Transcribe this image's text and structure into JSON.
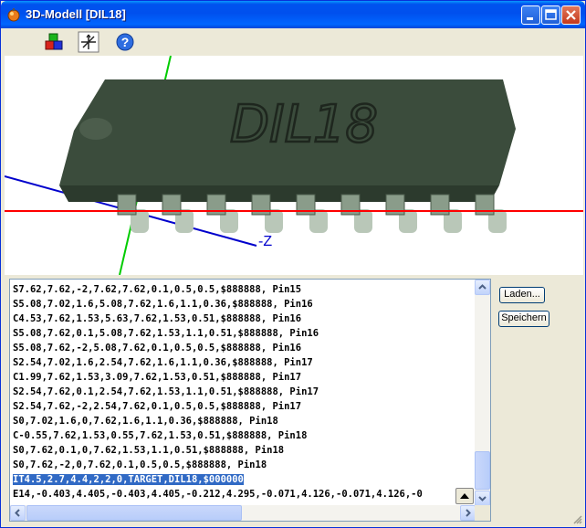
{
  "window": {
    "title": "3D-Modell  [DIL18]",
    "colors": {
      "titlebar": "#0054e3",
      "chip_body": "#3b4c3c",
      "chip_text": "#283028",
      "axis_x": "#ff0000",
      "axis_y": "#00cc00",
      "axis_z": "#0000cc"
    }
  },
  "toolbar": {
    "icons": [
      "color-cubes-icon",
      "axes-icon",
      "help-icon"
    ]
  },
  "view3d": {
    "chip_label": "DIL18",
    "axis_label": "-Z"
  },
  "editor": {
    "lines": [
      "S7.62,7.62,-2,7.62,7.62,0.1,0.5,0.5,$888888, Pin15",
      "S5.08,7.02,1.6,5.08,7.62,1.6,1.1,0.36,$888888, Pin16",
      "C4.53,7.62,1.53,5.63,7.62,1.53,0.51,$888888, Pin16",
      "S5.08,7.62,0.1,5.08,7.62,1.53,1.1,0.51,$888888, Pin16",
      "S5.08,7.62,-2,5.08,7.62,0.1,0.5,0.5,$888888, Pin16",
      "S2.54,7.02,1.6,2.54,7.62,1.6,1.1,0.36,$888888, Pin17",
      "C1.99,7.62,1.53,3.09,7.62,1.53,0.51,$888888, Pin17",
      "S2.54,7.62,0.1,2.54,7.62,1.53,1.1,0.51,$888888, Pin17",
      "S2.54,7.62,-2,2.54,7.62,0.1,0.5,0.5,$888888, Pin17",
      "S0,7.02,1.6,0,7.62,1.6,1.1,0.36,$888888, Pin18",
      "C-0.55,7.62,1.53,0.55,7.62,1.53,0.51,$888888, Pin18",
      "S0,7.62,0.1,0,7.62,1.53,1.1,0.51,$888888, Pin18",
      "S0,7.62,-2,0,7.62,0.1,0.5,0.5,$888888, Pin18",
      "IT4.5,2.7,4.4,2,2,0,TARGET,DIL18,$000000",
      "E14,-0.403,4.405,-0.403,4.405,-0.212,4.295,-0.071,4.126,-0.071,4.126,-0"
    ],
    "selected_line": 13
  },
  "buttons": {
    "load": "Laden...",
    "save": "Speichern"
  }
}
